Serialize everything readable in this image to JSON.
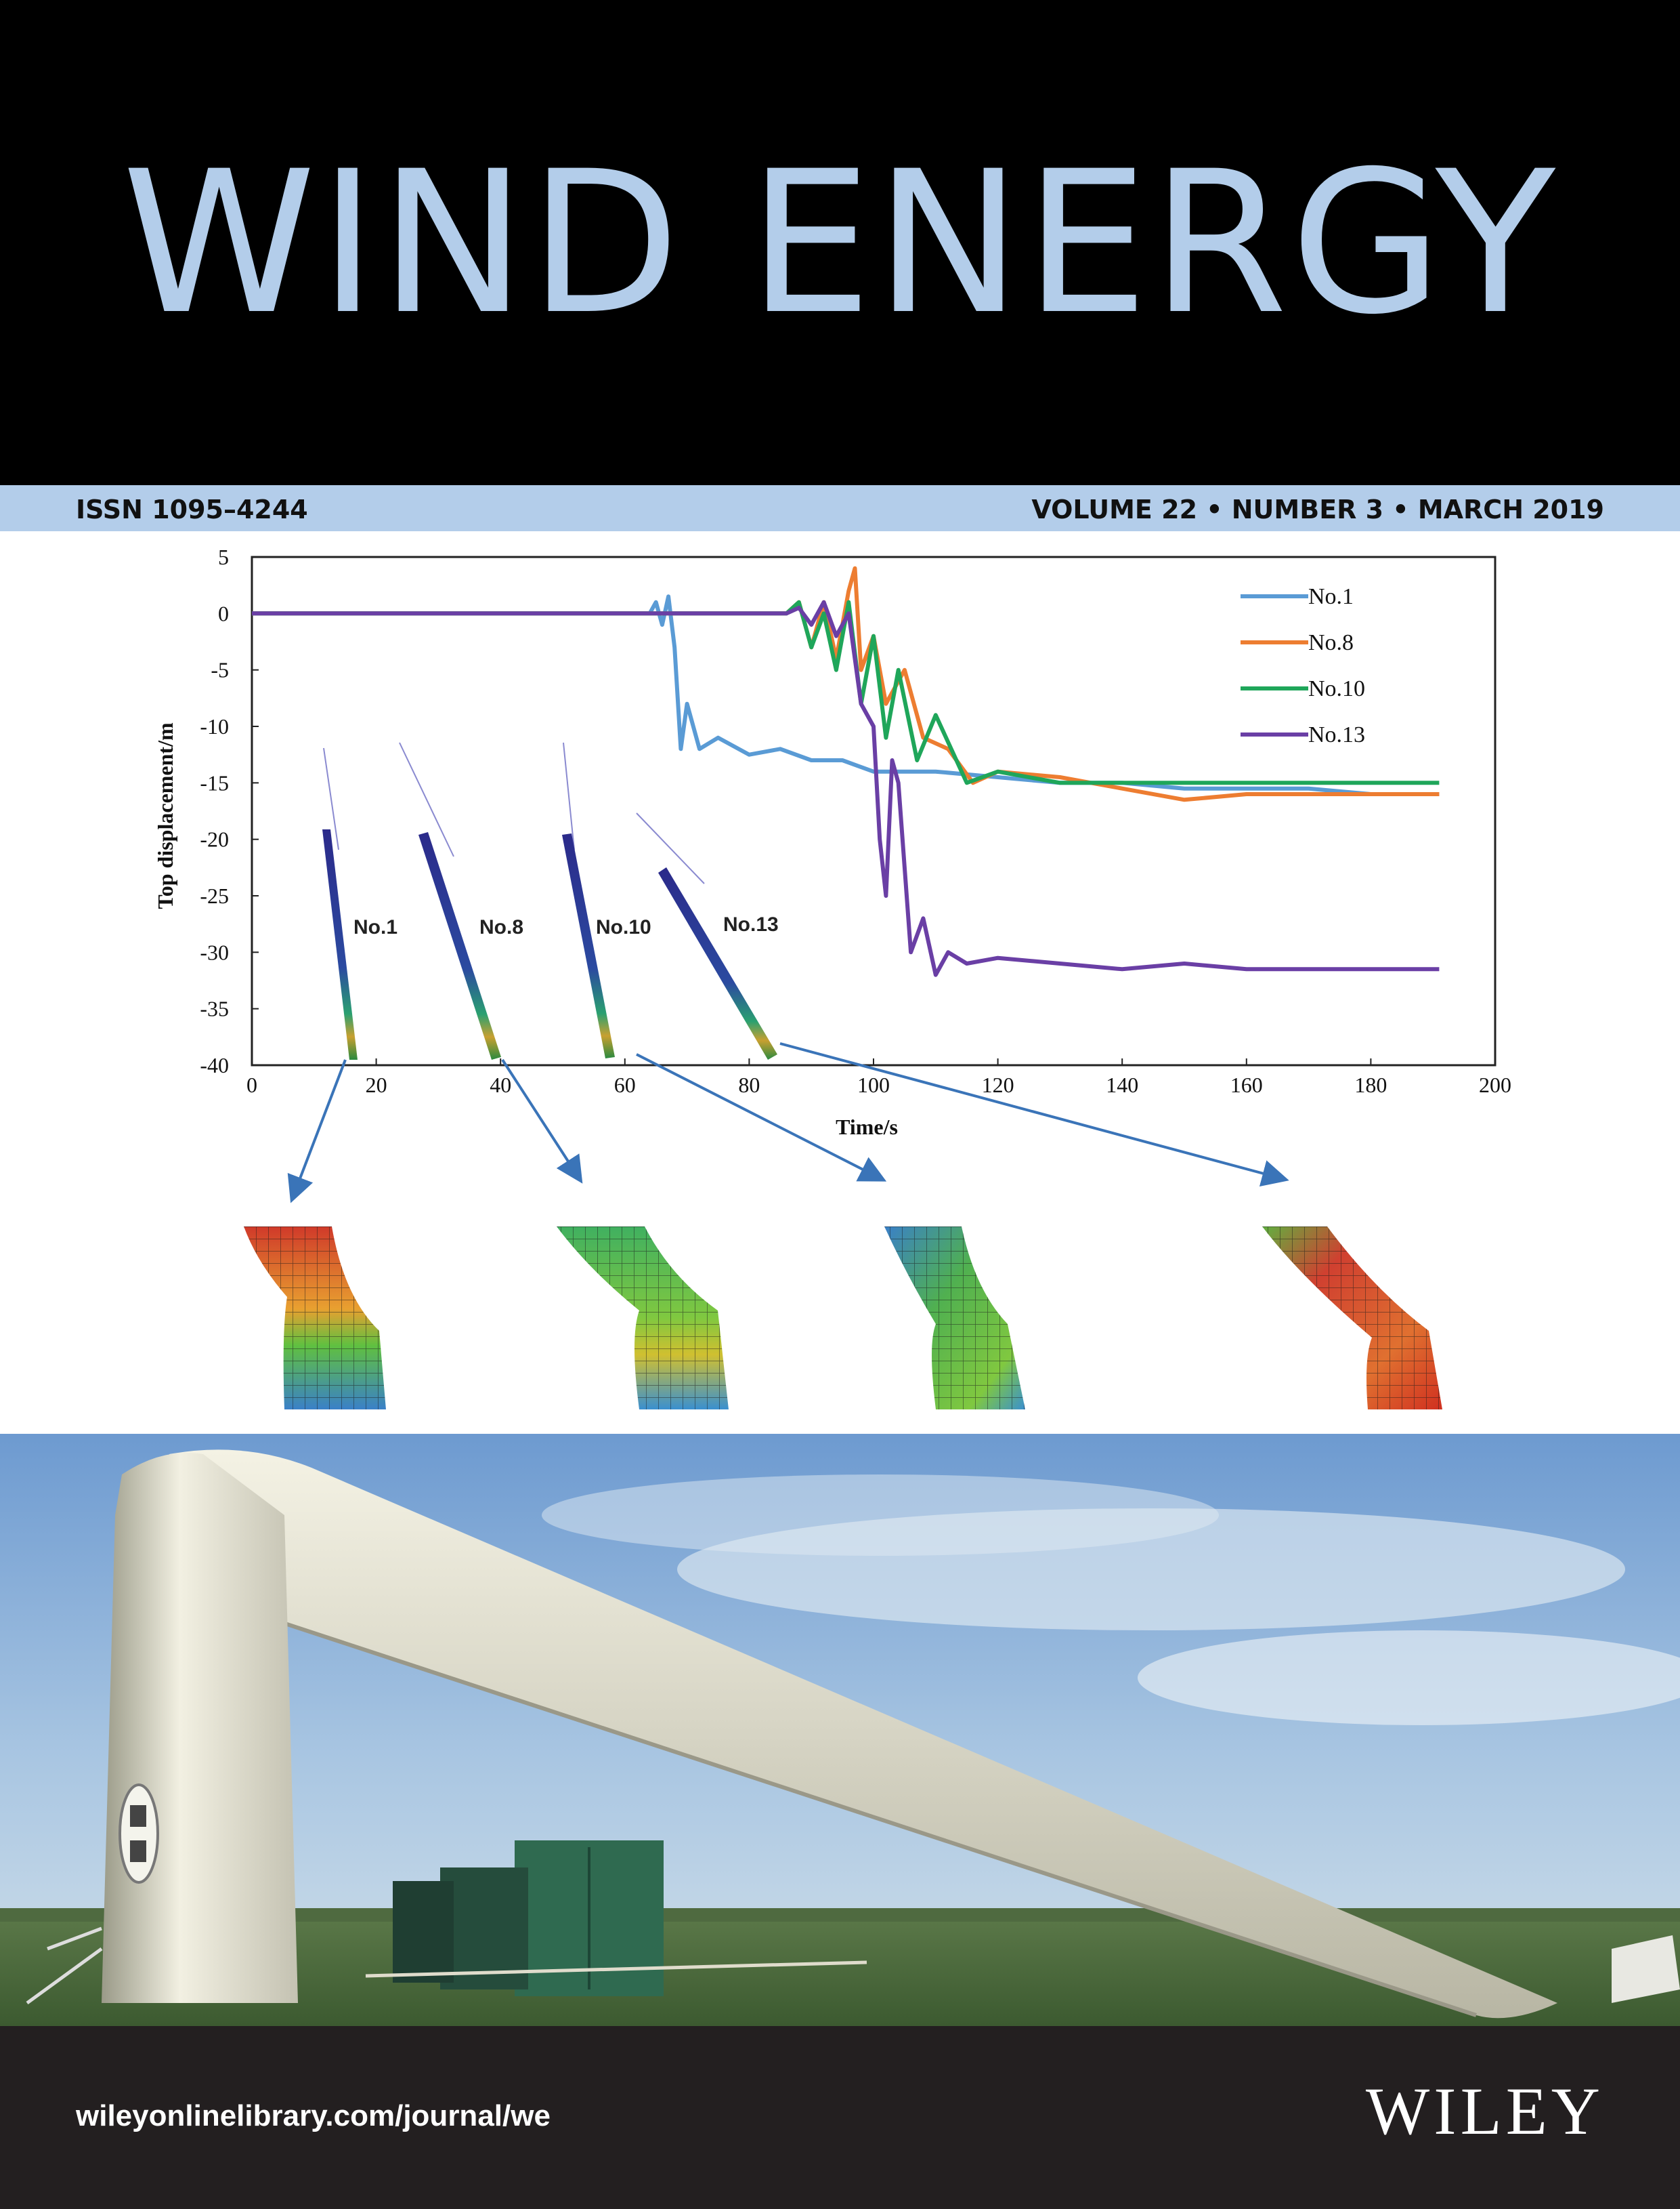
{
  "cover": {
    "title": "WIND ENERGY",
    "issn": "ISSN 1095–4244",
    "issue": "VOLUME 22 • NUMBER 3 • MARCH 2019",
    "url": "wileyonlinelibrary.com/journal/we",
    "publisher": "WILEY"
  },
  "colors": {
    "title": "#b3cdea",
    "bar": "#b3cdea",
    "masthead": "#000000",
    "footer": "#231f20"
  },
  "chart_data": {
    "type": "line",
    "title": "",
    "xlabel": "Time/s",
    "ylabel": "Top displacement/m",
    "xlim": [
      0,
      200
    ],
    "ylim": [
      -40,
      5
    ],
    "xticks": [
      0,
      20,
      40,
      60,
      80,
      100,
      120,
      140,
      160,
      180,
      200
    ],
    "yticks": [
      5,
      0,
      -5,
      -10,
      -15,
      -20,
      -25,
      -30,
      -35,
      -40
    ],
    "legend_position": "top-right",
    "series": [
      {
        "name": "No.1",
        "color": "#5a9bd5",
        "x": [
          0,
          64,
          65,
          66,
          67,
          68,
          69,
          70,
          72,
          75,
          80,
          85,
          90,
          95,
          100,
          110,
          120,
          130,
          140,
          150,
          160,
          170,
          180,
          191
        ],
        "y": [
          0,
          0,
          1,
          -1,
          1.5,
          -3,
          -12,
          -8,
          -12,
          -11,
          -12.5,
          -12,
          -13,
          -13,
          -14,
          -14,
          -14.5,
          -15,
          -15,
          -15.5,
          -15.5,
          -15.5,
          -16,
          -16
        ]
      },
      {
        "name": "No.8",
        "color": "#ed7d31",
        "x": [
          0,
          86,
          88,
          90,
          92,
          94,
          96,
          97,
          98,
          100,
          102,
          105,
          108,
          112,
          116,
          120,
          130,
          140,
          150,
          160,
          170,
          180,
          191
        ],
        "y": [
          0,
          0,
          1,
          -3,
          1,
          -4,
          2,
          4,
          -5,
          -2,
          -8,
          -5,
          -11,
          -12,
          -15,
          -14,
          -14.5,
          -15.5,
          -16.5,
          -16,
          -16,
          -16,
          -16
        ]
      },
      {
        "name": "No.10",
        "color": "#1fa65a",
        "x": [
          0,
          86,
          88,
          90,
          92,
          94,
          96,
          98,
          100,
          102,
          104,
          107,
          110,
          115,
          120,
          130,
          140,
          150,
          160,
          170,
          180,
          191
        ],
        "y": [
          0,
          0,
          1,
          -3,
          0,
          -5,
          1,
          -8,
          -2,
          -11,
          -5,
          -13,
          -9,
          -15,
          -14,
          -15,
          -15,
          -15,
          -15,
          -15,
          -15,
          -15
        ]
      },
      {
        "name": "No.13",
        "color": "#6a3fa5",
        "x": [
          0,
          86,
          88,
          90,
          92,
          94,
          96,
          98,
          100,
          101,
          102,
          103,
          104,
          106,
          108,
          110,
          112,
          115,
          120,
          130,
          140,
          150,
          160,
          170,
          180,
          191
        ],
        "y": [
          0,
          0,
          0.5,
          -1,
          1,
          -2,
          0,
          -8,
          -10,
          -20,
          -25,
          -13,
          -15,
          -30,
          -27,
          -32,
          -30,
          -31,
          -30.5,
          -31,
          -31.5,
          -31,
          -31.5,
          -31.5,
          -31.5,
          -31.5
        ]
      }
    ],
    "annotations": [
      "No.1",
      "No.8",
      "No.10",
      "No.13"
    ]
  }
}
